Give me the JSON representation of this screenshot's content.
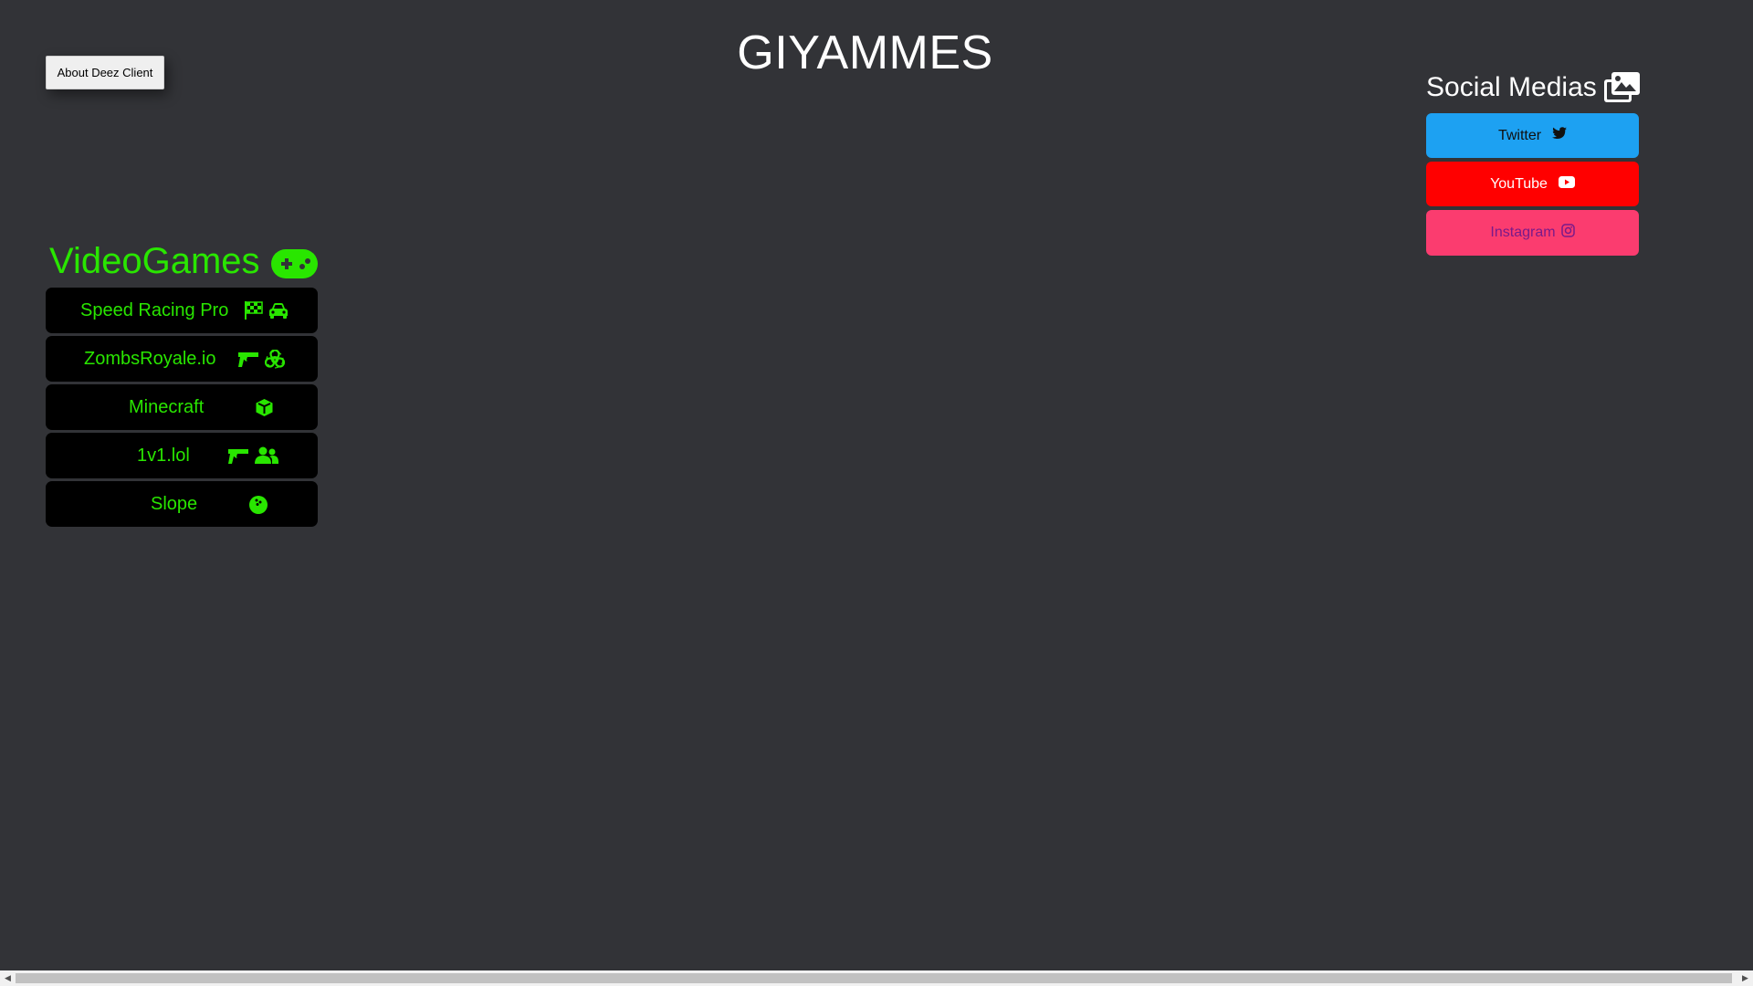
{
  "header": {
    "title": "GIYAMMES",
    "about_label": "About Deez Client"
  },
  "games": {
    "heading": "VideoGames",
    "heading_icon": "gamepad-icon",
    "accent_color": "#29e600",
    "items": [
      {
        "label": "Speed Racing Pro",
        "icons": [
          "checkered-flag-icon",
          "car-icon"
        ]
      },
      {
        "label": "ZombsRoyale.io",
        "icons": [
          "gun-icon",
          "biohazard-icon"
        ]
      },
      {
        "label": "Minecraft",
        "icons": [
          "cube-icon"
        ]
      },
      {
        "label": "1v1.lol",
        "icons": [
          "gun-icon",
          "users-icon"
        ]
      },
      {
        "label": "Slope",
        "icons": [
          "ball-icon"
        ]
      }
    ]
  },
  "social": {
    "heading": "Social Medias",
    "heading_icon": "photos-icon",
    "items": [
      {
        "label": "Twitter",
        "icon": "twitter-icon",
        "bg": "#1da1f2",
        "color": "#111111"
      },
      {
        "label": "YouTube",
        "icon": "youtube-icon",
        "bg": "#ff0000",
        "color": "#ffffff"
      },
      {
        "label": "Instagram",
        "icon": "instagram-icon",
        "bg": "#fb3c6f",
        "color": "#7a1a8a"
      }
    ]
  },
  "colors": {
    "background": "#323337"
  }
}
